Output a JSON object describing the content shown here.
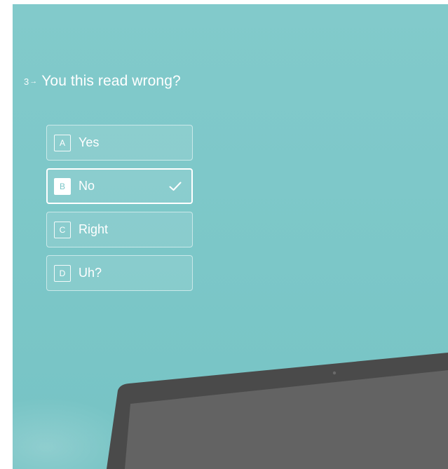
{
  "question": {
    "number": "3",
    "text": "You this read wrong?"
  },
  "options": [
    {
      "key": "A",
      "label": "Yes",
      "selected": false
    },
    {
      "key": "B",
      "label": "No",
      "selected": true
    },
    {
      "key": "C",
      "label": "Right",
      "selected": false
    },
    {
      "key": "D",
      "label": "Uh?",
      "selected": false
    }
  ],
  "colors": {
    "background": "#7cc7c8",
    "text": "#ffffff",
    "laptop_bezel": "#4a4a4a",
    "laptop_screen": "#636363"
  },
  "icons": {
    "arrow": "right-arrow-icon",
    "check": "checkmark-icon",
    "webcam": "webcam-icon"
  }
}
